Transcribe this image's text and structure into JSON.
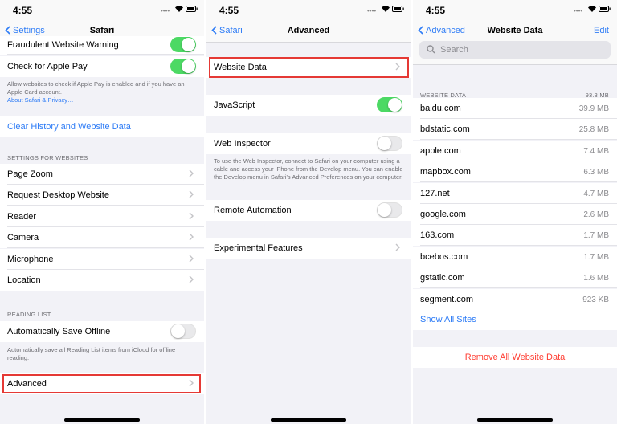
{
  "status": {
    "time": "4:55"
  },
  "safari": {
    "back": "Settings",
    "title": "Safari",
    "fraudulent": "Fraudulent Website Warning",
    "apple_pay": "Check for Apple Pay",
    "apple_pay_footer": "Allow websites to check if Apple Pay is enabled and if you have an Apple Card account.",
    "apple_pay_link": "About Safari & Privacy…",
    "clear_history": "Clear History and Website Data",
    "settings_header": "SETTINGS FOR WEBSITES",
    "website_items": [
      "Page Zoom",
      "Request Desktop Website",
      "Reader",
      "Camera",
      "Microphone",
      "Location"
    ],
    "reading_header": "READING LIST",
    "auto_save": "Automatically Save Offline",
    "auto_save_footer": "Automatically save all Reading List items from iCloud for offline reading.",
    "advanced": "Advanced"
  },
  "advanced": {
    "back": "Safari",
    "title": "Advanced",
    "website_data": "Website Data",
    "javascript": "JavaScript",
    "web_inspector": "Web Inspector",
    "web_inspector_footer": "To use the Web Inspector, connect to Safari on your computer using a cable and access your iPhone from the Develop menu. You can enable the Develop menu in Safari's Advanced Preferences on your computer.",
    "remote_automation": "Remote Automation",
    "experimental": "Experimental Features"
  },
  "website_data": {
    "back": "Advanced",
    "title": "Website Data",
    "edit": "Edit",
    "search_placeholder": "Search",
    "header": "WEBSITE DATA",
    "total": "93.3 MB",
    "sites": [
      {
        "name": "baidu.com",
        "size": "39.9 MB"
      },
      {
        "name": "bdstatic.com",
        "size": "25.8 MB"
      },
      {
        "name": "apple.com",
        "size": "7.4 MB"
      },
      {
        "name": "mapbox.com",
        "size": "6.3 MB"
      },
      {
        "name": "127.net",
        "size": "4.7 MB"
      },
      {
        "name": "google.com",
        "size": "2.6 MB"
      },
      {
        "name": "163.com",
        "size": "1.7 MB"
      },
      {
        "name": "bcebos.com",
        "size": "1.7 MB"
      },
      {
        "name": "gstatic.com",
        "size": "1.6 MB"
      },
      {
        "name": "segment.com",
        "size": "923 KB"
      }
    ],
    "show_all": "Show All Sites",
    "remove_all": "Remove All Website Data"
  },
  "colors": {
    "accent": "#2e7cf6",
    "toggle_on": "#4cd964",
    "destructive": "#ff3b30",
    "highlight": "#e53935"
  }
}
